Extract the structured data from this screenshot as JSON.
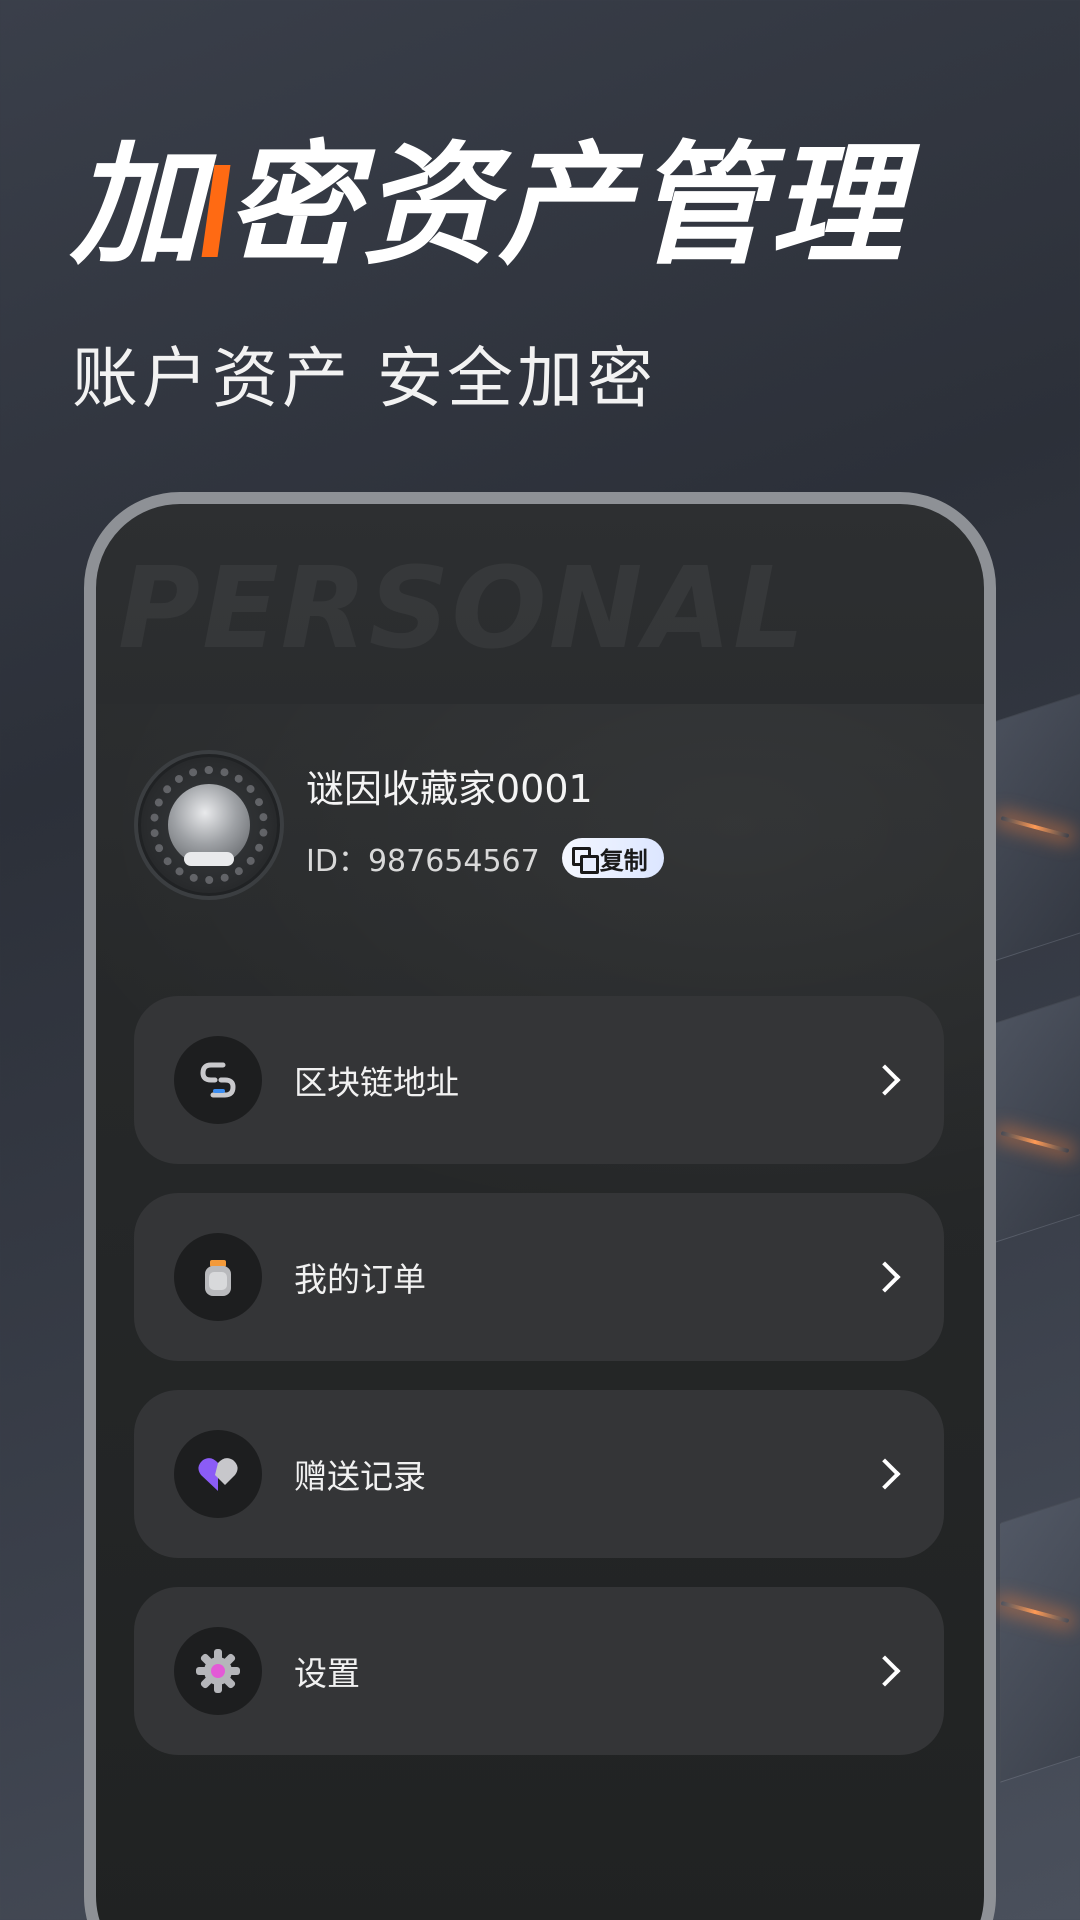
{
  "hero": {
    "title_part1": "加",
    "title_part2": "密资产管理",
    "subtitle": "账户资产 安全加密"
  },
  "phone": {
    "watermark": "PERSONAL",
    "profile": {
      "username": "谜因收藏家0001",
      "id_label": "ID：987654567",
      "copy_label": "复制"
    },
    "menu": [
      {
        "label": "区块链地址",
        "icon": "chain-link-icon"
      },
      {
        "label": "我的订单",
        "icon": "order-jar-icon"
      },
      {
        "label": "赠送记录",
        "icon": "gift-heart-icon"
      },
      {
        "label": "设置",
        "icon": "gear-icon"
      }
    ]
  },
  "colors": {
    "accent": "#ff6a13",
    "card": "#343537",
    "phone_bg": "#262829",
    "frame": "#8e9196"
  }
}
